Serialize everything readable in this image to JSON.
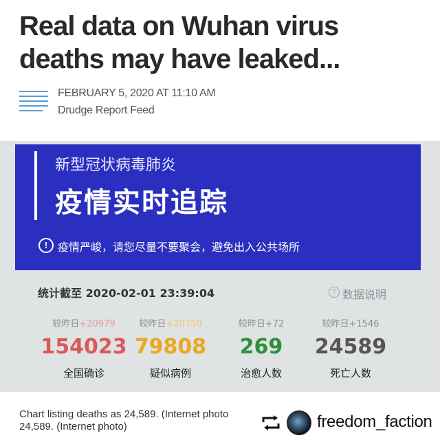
{
  "article": {
    "title": "Real data on Wuhan virus deaths may have leaked...",
    "date": "FEBRUARY 5, 2020 AT 11:10 AM",
    "source": "Drudge Report Feed",
    "caption": "Chart listing deaths as 24,589. (Internet photo\n24,589. (Internet photo)"
  },
  "photo": {
    "banner_subtitle": "新型冠状病毒肺炎",
    "banner_title": "疫情实时追踪",
    "banner_warning": "疫情严峻，请您尽量不要聚会，避免出入公共场所",
    "stats_label": "统计截至 2020-02-01 23:39:04",
    "data_note": "数据说明",
    "stats": [
      {
        "delta_prefix": "较昨日",
        "delta_value": "+20979",
        "value": "154023",
        "label": "全国确诊",
        "color": "#d95a5a",
        "delta_color": "#e89a9a"
      },
      {
        "delta_prefix": "较昨日",
        "delta_value": "+20750",
        "value": "79808",
        "label": "疑似病例",
        "color": "#e8a820",
        "delta_color": "#f0c86a"
      },
      {
        "delta_prefix": "较昨日",
        "delta_value": "+72",
        "value": "269",
        "label": "治愈人数",
        "color": "#2f8f3a",
        "delta_color": "#8c8c8c"
      },
      {
        "delta_prefix": "较昨日",
        "delta_value": "+1546",
        "value": "24589",
        "label": "死亡人数",
        "color": "#555555",
        "delta_color": "#8c8c8c"
      }
    ]
  },
  "repost": {
    "icon": "repost-icon",
    "handle": "freedom_faction"
  }
}
